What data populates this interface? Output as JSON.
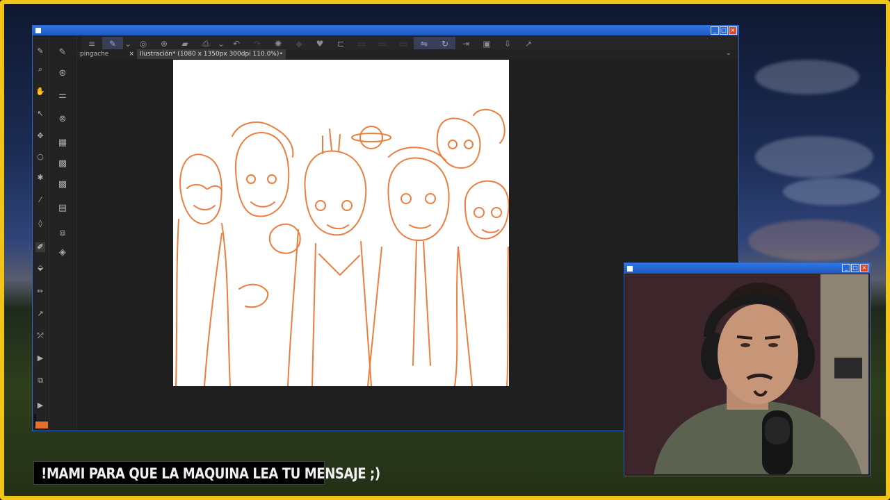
{
  "colors": {
    "frame": "#f0c419",
    "titlebar": "#2f75e3",
    "sketch": "#e9702a",
    "app_bg": "#1f1f1f"
  },
  "krita": {
    "toolbar_icons": [
      "menu-icon",
      "brush-preset-icon",
      "chevron-down-icon",
      "spiral-icon",
      "add-layer-icon",
      "open-folder-icon",
      "print-icon",
      "chevron-down-icon",
      "undo-icon",
      "spinner-icon",
      "heart-icon",
      "crop-icon",
      "mirror-horizontal-icon",
      "mirror-vertical-icon",
      "export-icon",
      "save-icon",
      "import-icon",
      "external-icon"
    ],
    "tabs": [
      {
        "label": "pingache",
        "close": "×"
      },
      {
        "label": "Ilustración* (1080 x 1350px 300dpi 110.0%)",
        "close": "•"
      }
    ],
    "tab_menu_icon": "chevron-down-icon",
    "tools": [
      "freehand-brush-icon",
      "transform-icon",
      "sliders-icon",
      "reference-icon",
      "pattern-icon",
      "grid-icon",
      "pattern2-icon",
      "calendar-icon",
      "layers-stack-icon",
      "layers-icon"
    ],
    "left_strip_tools": [
      "brush-icon",
      "zoom-icon",
      "hand-icon",
      "select-icon",
      "move-icon",
      "lasso-icon",
      "star-icon",
      "eyedropper-icon",
      "smudge-icon",
      "pen-icon",
      "fill-icon",
      "pencil-icon",
      "path-icon",
      "gradient-icon",
      "shape-icon",
      "play-icon"
    ]
  },
  "webcam": {
    "window_controls": [
      "minimize",
      "maximize",
      "close"
    ]
  },
  "banner": {
    "text": "!MAMI PARA QUE LA MAQUINA LEA TU MENSAJE ;)"
  }
}
